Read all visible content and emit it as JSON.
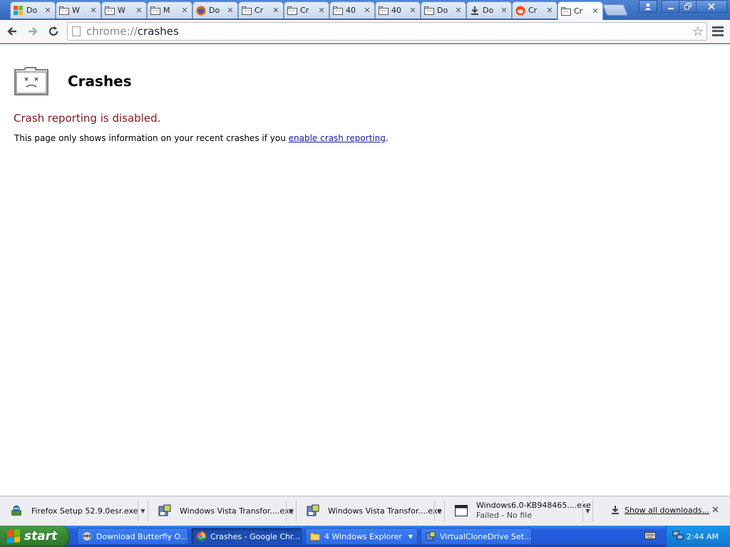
{
  "browser": {
    "tabs": [
      {
        "title": "Do",
        "icon": "windows-logo-icon"
      },
      {
        "title": "W",
        "icon": "sad-folder-icon"
      },
      {
        "title": "W",
        "icon": "sad-folder-icon"
      },
      {
        "title": "M",
        "icon": "sad-folder-icon"
      },
      {
        "title": "Do",
        "icon": "firefox-icon"
      },
      {
        "title": "Cr",
        "icon": "sad-folder-icon"
      },
      {
        "title": "Cr",
        "icon": "sad-folder-icon"
      },
      {
        "title": "40",
        "icon": "sad-folder-icon"
      },
      {
        "title": "40",
        "icon": "sad-folder-icon"
      },
      {
        "title": "Do",
        "icon": "sad-folder-icon"
      },
      {
        "title": "Do",
        "icon": "download-icon"
      },
      {
        "title": "Cr",
        "icon": "reddit-icon"
      },
      {
        "title": "Cr",
        "icon": "sad-folder-icon",
        "active": true
      }
    ],
    "tab_close_glyph": "✕",
    "url_scheme": "chrome://",
    "url_path": "crashes"
  },
  "page": {
    "title": "Crashes",
    "status_heading": "Crash reporting is disabled.",
    "info_prefix": "This page only shows information on your recent crashes if you ",
    "info_link": "enable crash reporting",
    "info_suffix": "."
  },
  "downloads": {
    "items": [
      {
        "name": "Firefox Setup 52.9.0esr.exe",
        "status": "",
        "icon": "installer-icon"
      },
      {
        "name": "Windows Vista Transfor....exe",
        "status": "",
        "icon": "setup-icon"
      },
      {
        "name": "Windows Vista Transfor....exe",
        "status": "",
        "icon": "setup-icon"
      },
      {
        "name": "Windows6.0-KB948465....exe",
        "status": "Failed - No file",
        "icon": "window-icon"
      }
    ],
    "show_all_label": "Show all downloads...",
    "close_glyph": "✕"
  },
  "taskbar": {
    "start_label": "start",
    "tasks": [
      {
        "label": "Download Butterfly O...",
        "icon": "raccoon-icon"
      },
      {
        "label": "Crashes - Google Chr...",
        "icon": "chrome-icon",
        "active": true
      },
      {
        "label": "4 Windows Explorer",
        "icon": "folder-icon"
      },
      {
        "label": "VirtualCloneDrive Set...",
        "icon": "setup-icon"
      }
    ],
    "clock": "2:44 AM"
  },
  "colors": {
    "status_heading": "#7e1a1a",
    "link": "#1a1aa6",
    "taskbar": "#245edc",
    "start_button": "#3b8d3a"
  }
}
